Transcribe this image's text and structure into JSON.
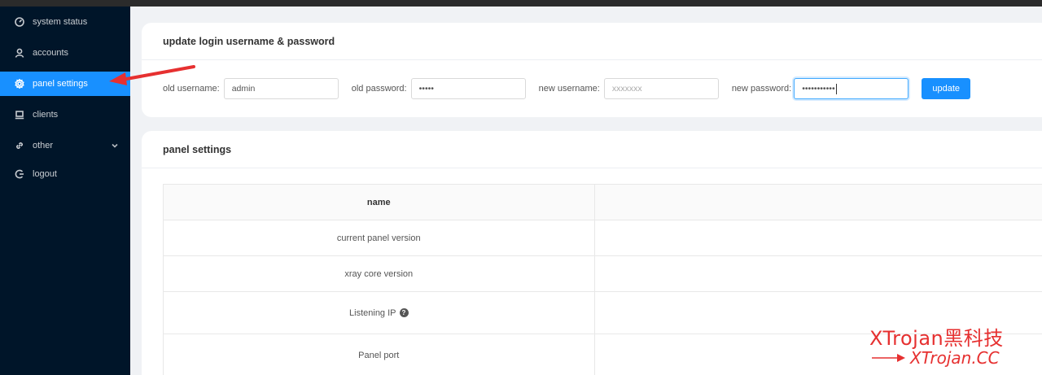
{
  "sidebar": {
    "items": [
      {
        "label": "system status",
        "icon": "dashboard-icon"
      },
      {
        "label": "accounts",
        "icon": "user-icon"
      },
      {
        "label": "panel settings",
        "icon": "gear-icon",
        "active": true
      },
      {
        "label": "clients",
        "icon": "laptop-icon"
      },
      {
        "label": "other",
        "icon": "link-icon",
        "has_children": true
      },
      {
        "label": "logout",
        "icon": "logout-icon"
      }
    ]
  },
  "login_card": {
    "title": "update login username & password",
    "old_username_label": "old username:",
    "old_username_value": "admin",
    "old_password_label": "old password:",
    "old_password_value": "•••••",
    "new_username_label": "new username:",
    "new_username_placeholder": "xxxxxxx",
    "new_password_label": "new password:",
    "new_password_value": "•••••••••••",
    "update_button": "update"
  },
  "settings_card": {
    "title": "panel settings",
    "table": {
      "header": "name",
      "rows": [
        {
          "name": "current panel version"
        },
        {
          "name": "xray core version"
        },
        {
          "name": "Listening IP",
          "help": "?"
        },
        {
          "name": "Panel port"
        }
      ]
    }
  },
  "watermark": {
    "line1": "XTrojan黑科技",
    "line2": "XTrojan.CC"
  },
  "colors": {
    "sidebar_bg": "#001529",
    "accent": "#1890ff",
    "annotation": "#e63030"
  }
}
